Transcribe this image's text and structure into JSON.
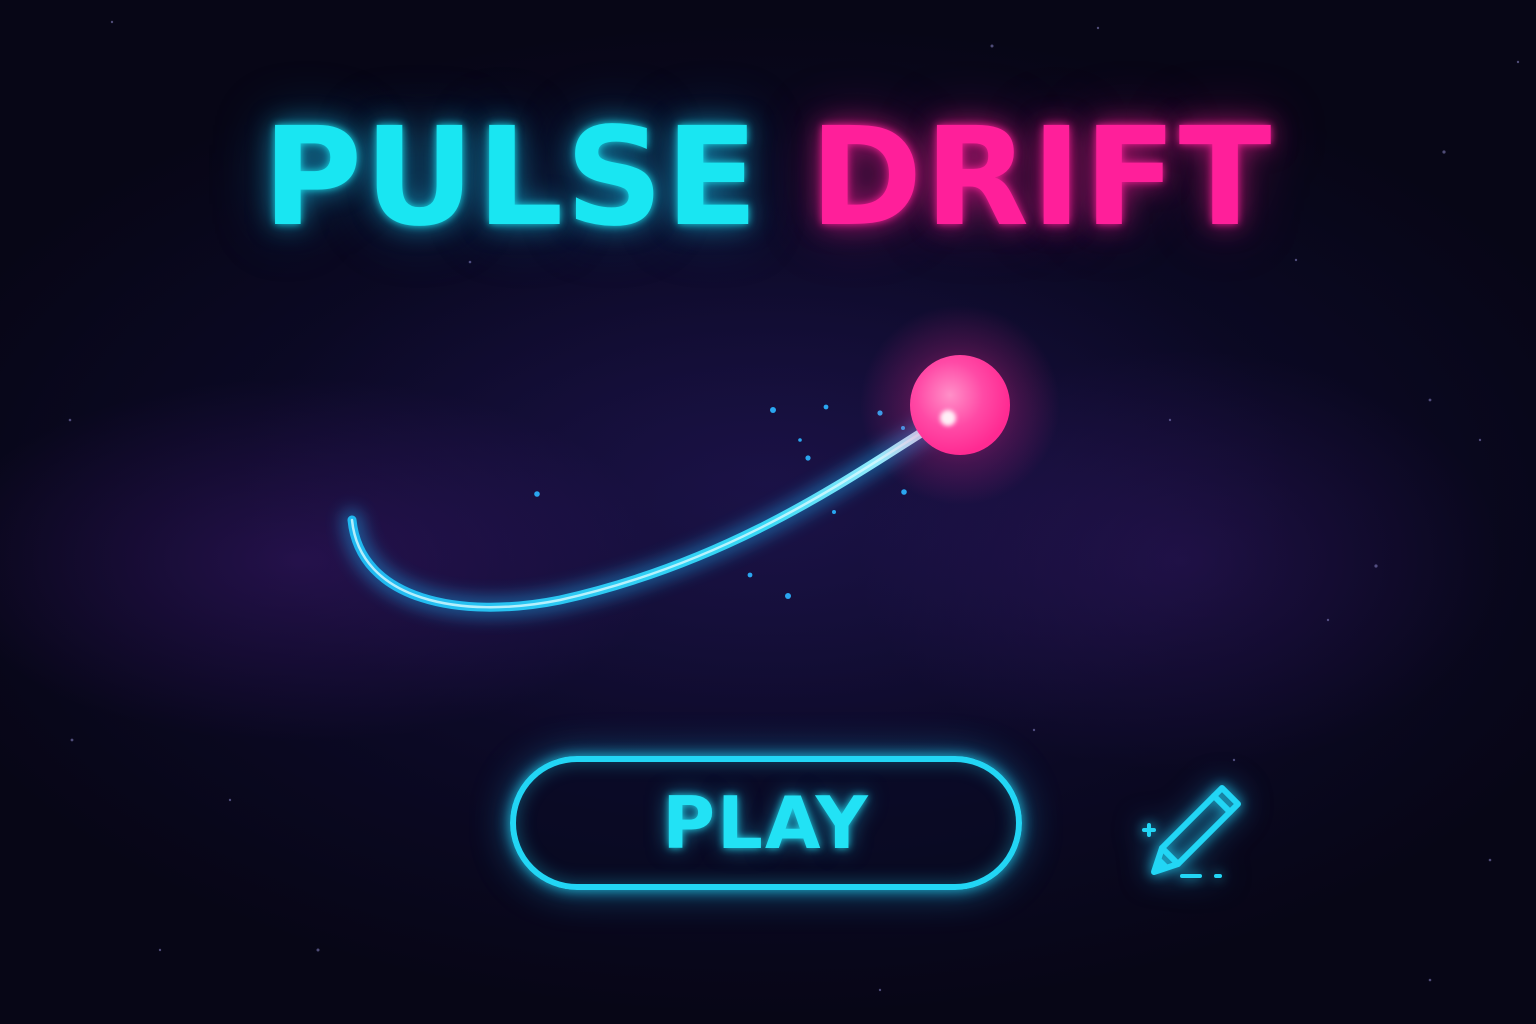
{
  "title": {
    "word_1": "PULSE",
    "word_2": "DRIFT"
  },
  "play_button": {
    "label": "PLAY"
  },
  "edit_button": {
    "icon": "pencil-icon"
  },
  "colors": {
    "cyan": "#19e6f2",
    "magenta": "#ff1f9a",
    "background": "#0a0820"
  }
}
